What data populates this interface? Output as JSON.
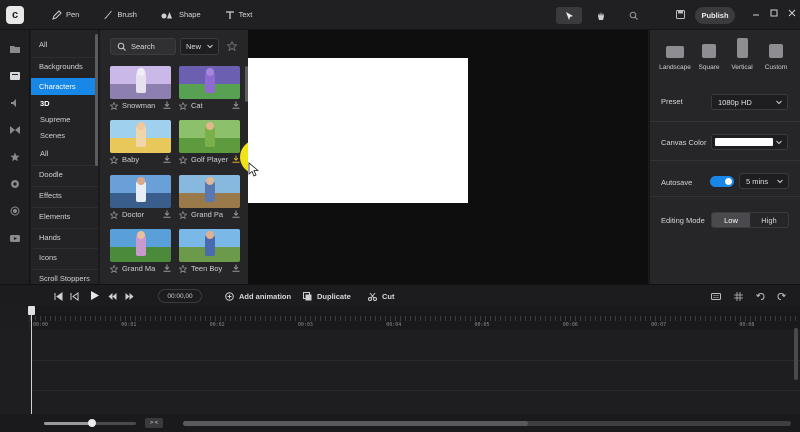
{
  "topbar": {
    "tools": [
      {
        "label": "Pen",
        "icon": "pen-icon"
      },
      {
        "label": "Brush",
        "icon": "brush-icon"
      },
      {
        "label": "Shape",
        "icon": "shape-icon"
      },
      {
        "label": "Text",
        "icon": "text-icon"
      }
    ],
    "publish_label": "Publish"
  },
  "categories": {
    "items": [
      "All",
      "Backgrounds",
      "Characters"
    ],
    "active": "Characters",
    "subitems": [
      "3D",
      "Supreme",
      "Scenes",
      "All"
    ],
    "more": [
      "Doodle",
      "Effects",
      "Elements",
      "Hands",
      "Icons",
      "Scroll Stoppers"
    ]
  },
  "assets": {
    "search_placeholder": "Search",
    "sort_value": "New",
    "items": [
      {
        "name": "Snowman",
        "sky": "#c9b8e8",
        "ground": "#8d7fb0",
        "fig": "#e6e0ef",
        "head": "#f2eef6"
      },
      {
        "name": "Cat",
        "sky": "#6a5fb0",
        "ground": "#58a052",
        "fig": "#8f6ad0",
        "head": "#a585de"
      },
      {
        "name": "Baby",
        "sky": "#9fd0ee",
        "ground": "#e8c85a",
        "fig": "#f0d6a8",
        "head": "#f2c89a"
      },
      {
        "name": "Golf Player",
        "sky": "#8cc06a",
        "ground": "#5e9a3e",
        "fig": "#7ab04a",
        "head": "#e2b68a"
      },
      {
        "name": "Doctor",
        "sky": "#6aa0d8",
        "ground": "#3a5e8c",
        "fig": "#e8eef4",
        "head": "#d8a888"
      },
      {
        "name": "Grand Pa",
        "sky": "#87b9df",
        "ground": "#9a7a4a",
        "fig": "#5a78b0",
        "head": "#e0b898"
      },
      {
        "name": "Grand Ma",
        "sky": "#5aa0d8",
        "ground": "#4a8a3a",
        "fig": "#c89ad0",
        "head": "#e8c0a0"
      },
      {
        "name": "Teen Boy",
        "sky": "#7ab8e8",
        "ground": "#6a9a4a",
        "fig": "#4a6ab0",
        "head": "#e0b090"
      }
    ]
  },
  "props": {
    "ratios": [
      "Landscape",
      "Square",
      "Vertical",
      "Custom"
    ],
    "preset_label": "Preset",
    "preset_value": "1080p HD",
    "canvas_color_label": "Canvas Color",
    "canvas_color": "#ffffff",
    "autosave_label": "Autosave",
    "autosave_interval": "5 mins",
    "editing_mode_label": "Editing Mode",
    "editing_modes": [
      "Low",
      "High"
    ],
    "editing_mode_active": "Low"
  },
  "timeline": {
    "current_time": "00:00,00",
    "add_animation_label": "Add animation",
    "duplicate_label": "Duplicate",
    "cut_label": "Cut",
    "ticks": [
      "00:00",
      "00:01",
      "00:02",
      "00:03",
      "00:04",
      "00:05",
      "00:06",
      "00:07",
      "00:08"
    ],
    "fit_label": "> <"
  },
  "colors": {
    "accent": "#1787e8",
    "cursor_highlight": "#f2e21a"
  }
}
